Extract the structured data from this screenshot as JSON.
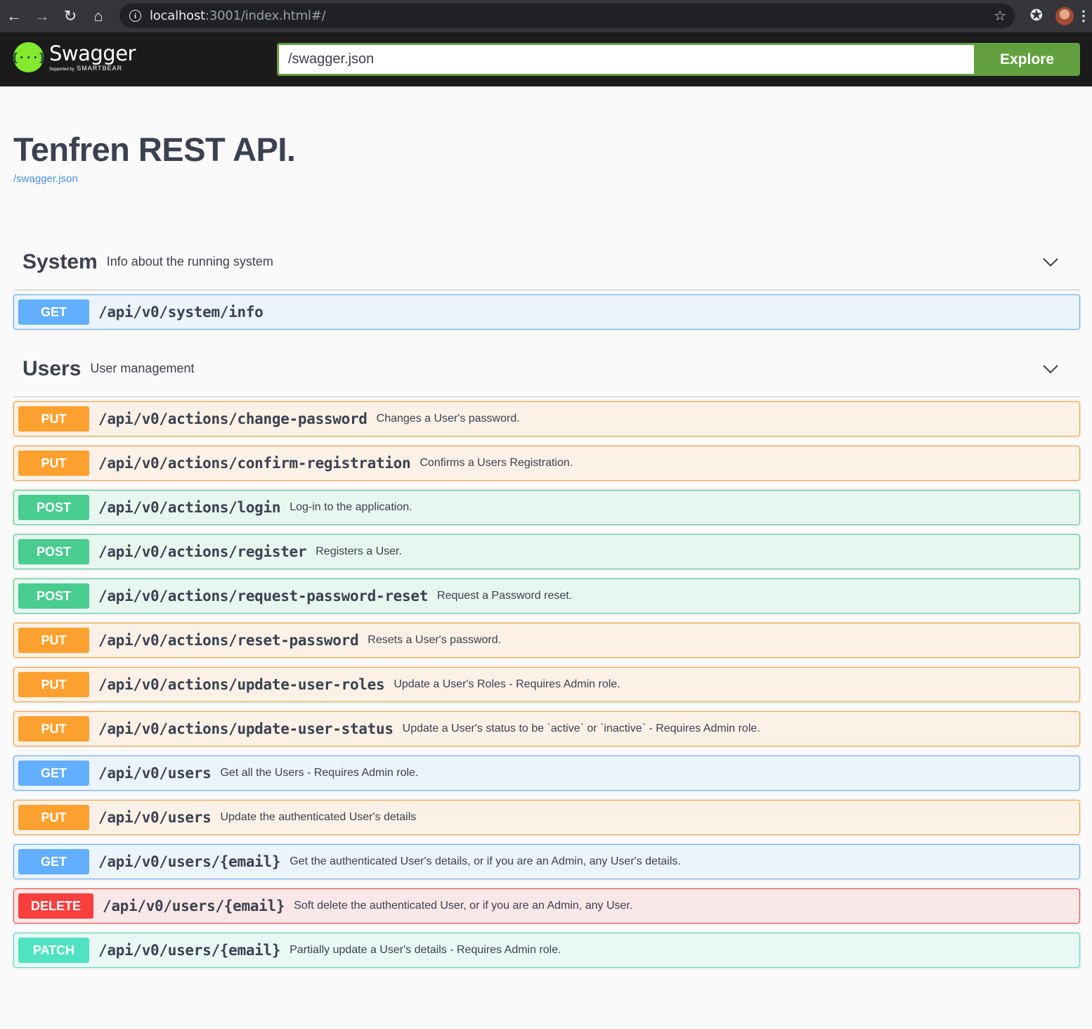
{
  "browser": {
    "url_host": "localhost",
    "url_rest": ":3001/index.html#/"
  },
  "topbar": {
    "logo_symbol": "{···}",
    "logo_word": "Swagger",
    "logo_sub_small": "Supported by",
    "logo_sub": "SMARTBEAR",
    "spec_url": "/swagger.json",
    "explore_label": "Explore"
  },
  "info": {
    "title": "Tenfren REST API.",
    "spec_link": "/swagger.json"
  },
  "tags": [
    {
      "name": "System",
      "description": "Info about the running system",
      "operations": [
        {
          "method": "GET",
          "path": "/api/v0/system/info",
          "summary": ""
        }
      ]
    },
    {
      "name": "Users",
      "description": "User management",
      "operations": [
        {
          "method": "PUT",
          "path": "/api/v0/actions/change-password",
          "summary": "Changes a User's password."
        },
        {
          "method": "PUT",
          "path": "/api/v0/actions/confirm-registration",
          "summary": "Confirms a Users Registration."
        },
        {
          "method": "POST",
          "path": "/api/v0/actions/login",
          "summary": "Log-in to the application."
        },
        {
          "method": "POST",
          "path": "/api/v0/actions/register",
          "summary": "Registers a User."
        },
        {
          "method": "POST",
          "path": "/api/v0/actions/request-password-reset",
          "summary": "Request a Password reset."
        },
        {
          "method": "PUT",
          "path": "/api/v0/actions/reset-password",
          "summary": "Resets a User's password."
        },
        {
          "method": "PUT",
          "path": "/api/v0/actions/update-user-roles",
          "summary": "Update a User's Roles - Requires Admin role."
        },
        {
          "method": "PUT",
          "path": "/api/v0/actions/update-user-status",
          "summary": "Update a User's status to be `active` or `inactive` - Requires Admin role."
        },
        {
          "method": "GET",
          "path": "/api/v0/users",
          "summary": "Get all the Users - Requires Admin role."
        },
        {
          "method": "PUT",
          "path": "/api/v0/users",
          "summary": "Update the authenticated User's details"
        },
        {
          "method": "GET",
          "path": "/api/v0/users/{email}",
          "summary": "Get the authenticated User's details, or if you are an Admin, any User's details."
        },
        {
          "method": "DELETE",
          "path": "/api/v0/users/{email}",
          "summary": "Soft delete the authenticated User, or if you are an Admin, any User."
        },
        {
          "method": "PATCH",
          "path": "/api/v0/users/{email}",
          "summary": "Partially update a User's details - Requires Admin role."
        }
      ]
    }
  ],
  "colors": {
    "get": "#61affe",
    "put": "#fca130",
    "post": "#49cc90",
    "delete": "#f93e3e",
    "patch": "#50e3c2",
    "explore": "#62a03f"
  }
}
